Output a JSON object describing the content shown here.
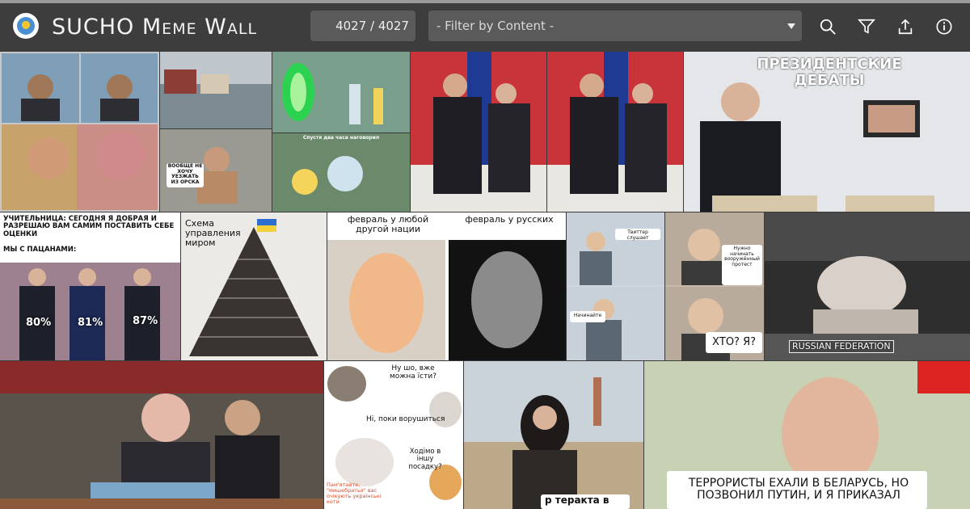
{
  "app": {
    "title": "SUCHO Meme Wall",
    "counter": "4027 / 4027",
    "filter_placeholder": "- Filter by Content -"
  },
  "toolbar": {
    "search_icon": "search-icon",
    "filter_icon": "funnel-icon",
    "share_icon": "share-icon",
    "info_icon": "info-icon"
  },
  "memes": {
    "debates_caption": "ПРЕЗИДЕНТСКИЕ ДЕБАТЫ",
    "grades_caption_1": "УЧИТЕЛЬНИЦА: СЕГОДНЯ Я ДОБРАЯ И РАЗРЕШАЮ ВАМ САМИМ ПОСТАВИТЬ СЕБЕ ОЦЕНКИ",
    "grades_caption_2": "МЫ С ПАЦАНАМИ:",
    "pct_1": "80%",
    "pct_2": "81%",
    "pct_3": "87%",
    "pyramid_title": "Схема управления миром",
    "feb_left": "февраль у любой другой нации",
    "feb_right": "февраль у русских",
    "operator_1": "Твиттер слушает",
    "operator_2": "Начинайте",
    "grandma_1": "Нужно начинать вооружённый протест",
    "grandma_2": "ХТО? Я?",
    "pig_label": "RUSSIAN FEDERATION",
    "cat_1": "Ну шо, вже можна їсти?",
    "cat_2": "Ні, поки ворушиться",
    "cat_3": "Ходімо в іншу посадку?",
    "cat_4": "Пам'ятайте, \"мишебратья\" вас очікують українські коти",
    "teract": "р теракта в",
    "lukash": "ТЕРРОРИСТЫ ЕХАЛИ В БЕЛАРУСЬ, НО ПОЗВОНИЛ ПУТИН, И Я ПРИКАЗАЛ",
    "car_caption": "ВООБЩЕ НЕ ХОЧУ УЕЗЖАТЬ ИЗ ОРСКА",
    "rick_caption": "Спустя два часа наговорил"
  }
}
